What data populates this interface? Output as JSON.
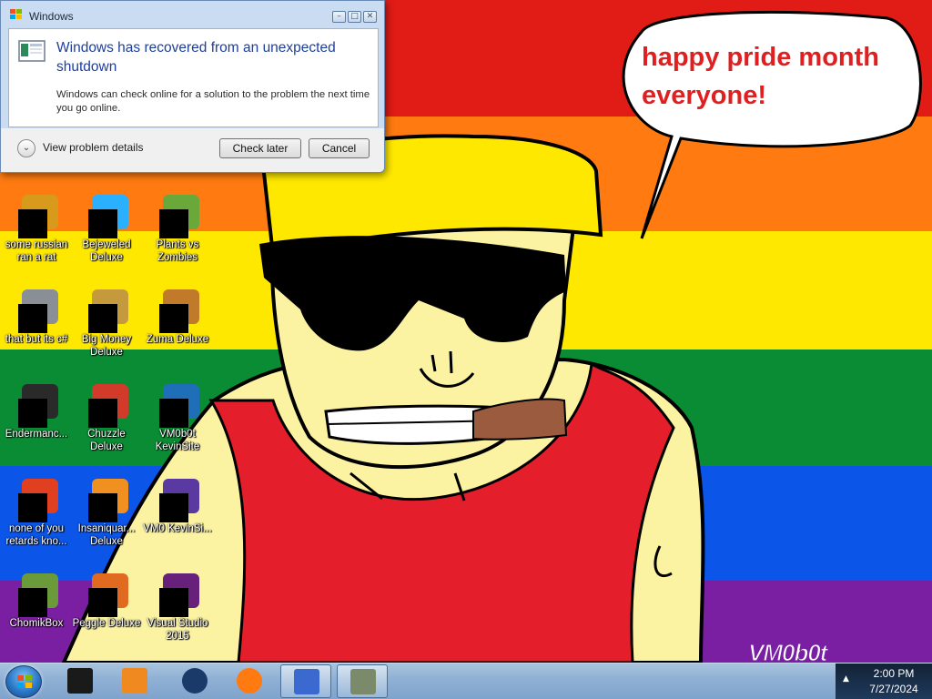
{
  "wallpaper": {
    "stripe_colors": [
      "#e11b16",
      "#ff7a10",
      "#ffe800",
      "#0a8c34",
      "#0b55e8",
      "#7a1fa2"
    ],
    "speech_bubble_text": "happy pride month everyone!",
    "signature": "VM0b0t"
  },
  "dialog": {
    "window_title": "Windows",
    "headline": "Windows has recovered from an unexpected shutdown",
    "description": "Windows can check online for a solution to the problem the next time you go online.",
    "details_label": "View problem details",
    "check_later_label": "Check later",
    "cancel_label": "Cancel",
    "caption_minimize": "–",
    "caption_maximize": "□",
    "caption_close": "✕"
  },
  "desktop_icons": [
    {
      "label": "some russian ran a rat",
      "icon": "rat-app-icon",
      "color": "#d89a1a"
    },
    {
      "label": "Bejeweled Deluxe",
      "icon": "gem-icon",
      "color": "#2bb0ff"
    },
    {
      "label": "Plants vs Zombies",
      "icon": "plant-icon",
      "color": "#6aa83a"
    },
    {
      "label": "that but its c#",
      "icon": "window-stack-icon",
      "color": "#8a8f96"
    },
    {
      "label": "Big Money Deluxe",
      "icon": "money-bag-icon",
      "color": "#c49a3c"
    },
    {
      "label": "Zuma Deluxe",
      "icon": "frog-idol-icon",
      "color": "#c07a2a"
    },
    {
      "label": "Endermanc...",
      "icon": "terminal-icon",
      "color": "#2a2a2a"
    },
    {
      "label": "Chuzzle Deluxe",
      "icon": "chuzzle-icon",
      "color": "#d23a2a"
    },
    {
      "label": "VM0b0t KevinSite",
      "icon": "folder-icon",
      "color": "#1e6fb8"
    },
    {
      "label": "none of you retards kno...",
      "icon": "red-circle-icon",
      "color": "#e04020"
    },
    {
      "label": "Insaniquar... Deluxe",
      "icon": "fish-icon",
      "color": "#f09020"
    },
    {
      "label": "VM0 KevinSi...",
      "icon": "file-icon",
      "color": "#5a3aa0"
    },
    {
      "label": "ChomikBox",
      "icon": "hamster-icon",
      "color": "#6a9a3a"
    },
    {
      "label": "Peggle Deluxe",
      "icon": "peggle-icon",
      "color": "#e06a20"
    },
    {
      "label": "Visual Studio 2015",
      "icon": "visual-studio-icon",
      "color": "#68217a"
    }
  ],
  "taskbar": {
    "items": [
      {
        "icon": "black-box-icon",
        "color": "#1a1a1a"
      },
      {
        "icon": "media-player-icon",
        "color": "#f08a20"
      },
      {
        "icon": "globe-icon",
        "color": "#1a3a6a"
      },
      {
        "icon": "firefox-icon",
        "color": "#ff7a10"
      },
      {
        "icon": "checklist-icon",
        "color": "#3a6ad0"
      },
      {
        "icon": "chomikbox-icon",
        "color": "#7a8a6a"
      }
    ],
    "tray_chevron": "▲",
    "time": "2:00 PM",
    "date": "7/27/2024"
  }
}
